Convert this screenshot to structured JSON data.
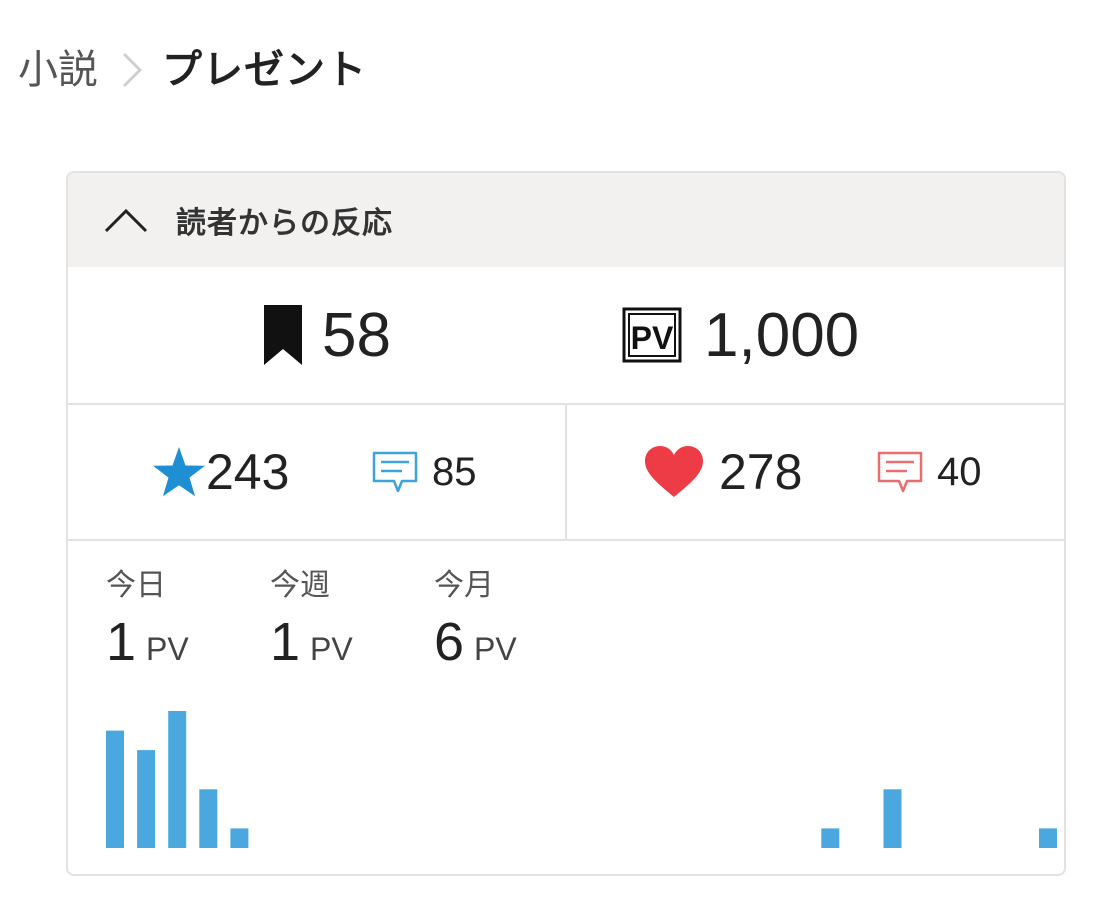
{
  "breadcrumb": {
    "parent": "小説",
    "current": "プレゼント"
  },
  "panel": {
    "title": "読者からの反応",
    "bookmarks": "58",
    "pv_total": "1,000",
    "stars": "243",
    "star_reviews": "85",
    "hearts": "278",
    "heart_comments": "40",
    "icons": [
      "chevron-up-icon",
      "bookmark-icon",
      "pv-icon",
      "star-icon",
      "review-icon",
      "heart-icon",
      "comment-icon"
    ],
    "colors": {
      "star": "#1e8fd3",
      "heart": "#ee3c47",
      "review": "#3ea3dc",
      "comment": "#ea6e6e",
      "bars": "#4aa8df"
    }
  },
  "periods": {
    "today": {
      "label": "今日",
      "value": "1",
      "unit": "PV"
    },
    "week": {
      "label": "今週",
      "value": "1",
      "unit": "PV"
    },
    "month": {
      "label": "今月",
      "value": "6",
      "unit": "PV"
    }
  },
  "chart_data": {
    "type": "bar",
    "values": [
      6,
      5,
      7,
      3,
      1,
      0,
      0,
      0,
      0,
      0,
      0,
      0,
      0,
      0,
      0,
      0,
      0,
      0,
      0,
      0,
      0,
      0,
      0,
      1,
      0,
      3,
      0,
      0,
      0,
      0,
      1
    ],
    "ylim": [
      0,
      7
    ],
    "title": "",
    "xlabel": "",
    "ylabel": ""
  }
}
